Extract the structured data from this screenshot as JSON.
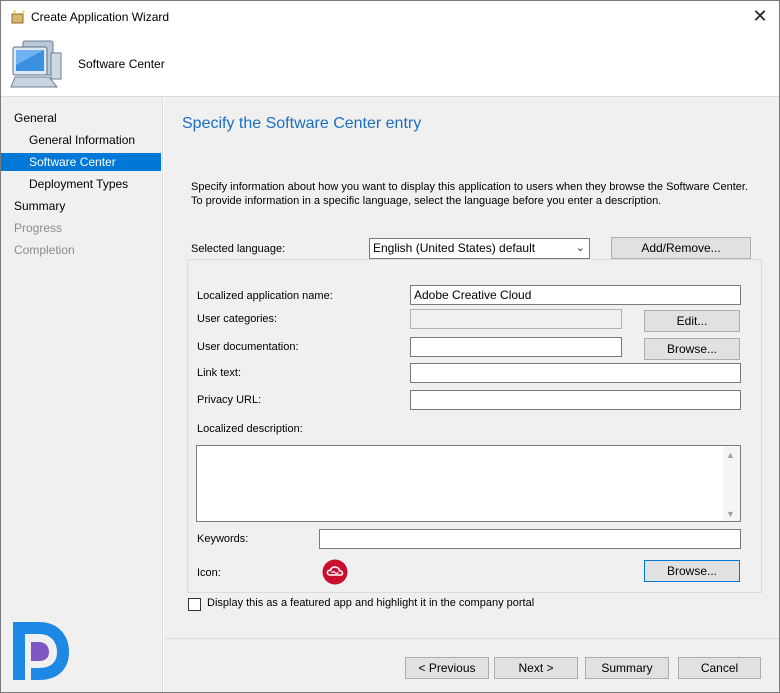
{
  "window": {
    "title": "Create Application Wizard",
    "close_glyph": "✕"
  },
  "header": {
    "title": "Software Center"
  },
  "sidebar": {
    "items": [
      {
        "label": "General",
        "level": 1,
        "state": "normal"
      },
      {
        "label": "General Information",
        "level": 2,
        "state": "normal"
      },
      {
        "label": "Software Center",
        "level": 2,
        "state": "selected"
      },
      {
        "label": "Deployment Types",
        "level": 2,
        "state": "normal"
      },
      {
        "label": "Summary",
        "level": 1,
        "state": "normal"
      },
      {
        "label": "Progress",
        "level": 1,
        "state": "disabled"
      },
      {
        "label": "Completion",
        "level": 1,
        "state": "disabled"
      }
    ]
  },
  "main": {
    "title": "Specify the Software Center entry",
    "intro": "Specify information about how you want to display this application to users when they browse the Software Center. To provide information in a specific language, select the language before you enter a description.",
    "language_label": "Selected language:",
    "language_value": "English (United States) default",
    "add_remove_label": "Add/Remove...",
    "fields": {
      "app_name_label": "Localized application name:",
      "app_name_value": "Adobe Creative Cloud",
      "categories_label": "User categories:",
      "categories_value": "",
      "edit_label": "Edit...",
      "documentation_label": "User documentation:",
      "documentation_value": "",
      "doc_browse_label": "Browse...",
      "link_text_label": "Link text:",
      "link_text_value": "",
      "privacy_label": "Privacy URL:",
      "privacy_value": "",
      "description_label": "Localized description:",
      "description_value": "",
      "keywords_label": "Keywords:",
      "keywords_value": "",
      "icon_label": "Icon:",
      "icon_browse_label": "Browse..."
    },
    "featured_label": "Display this as a featured app and highlight it in the company portal",
    "featured_checked": false
  },
  "footer": {
    "previous": "< Previous",
    "next": "Next >",
    "summary": "Summary",
    "cancel": "Cancel"
  },
  "colors": {
    "accent": "#0078d7",
    "title_blue": "#1a6fc2",
    "adobe_red": "#c8102e"
  }
}
